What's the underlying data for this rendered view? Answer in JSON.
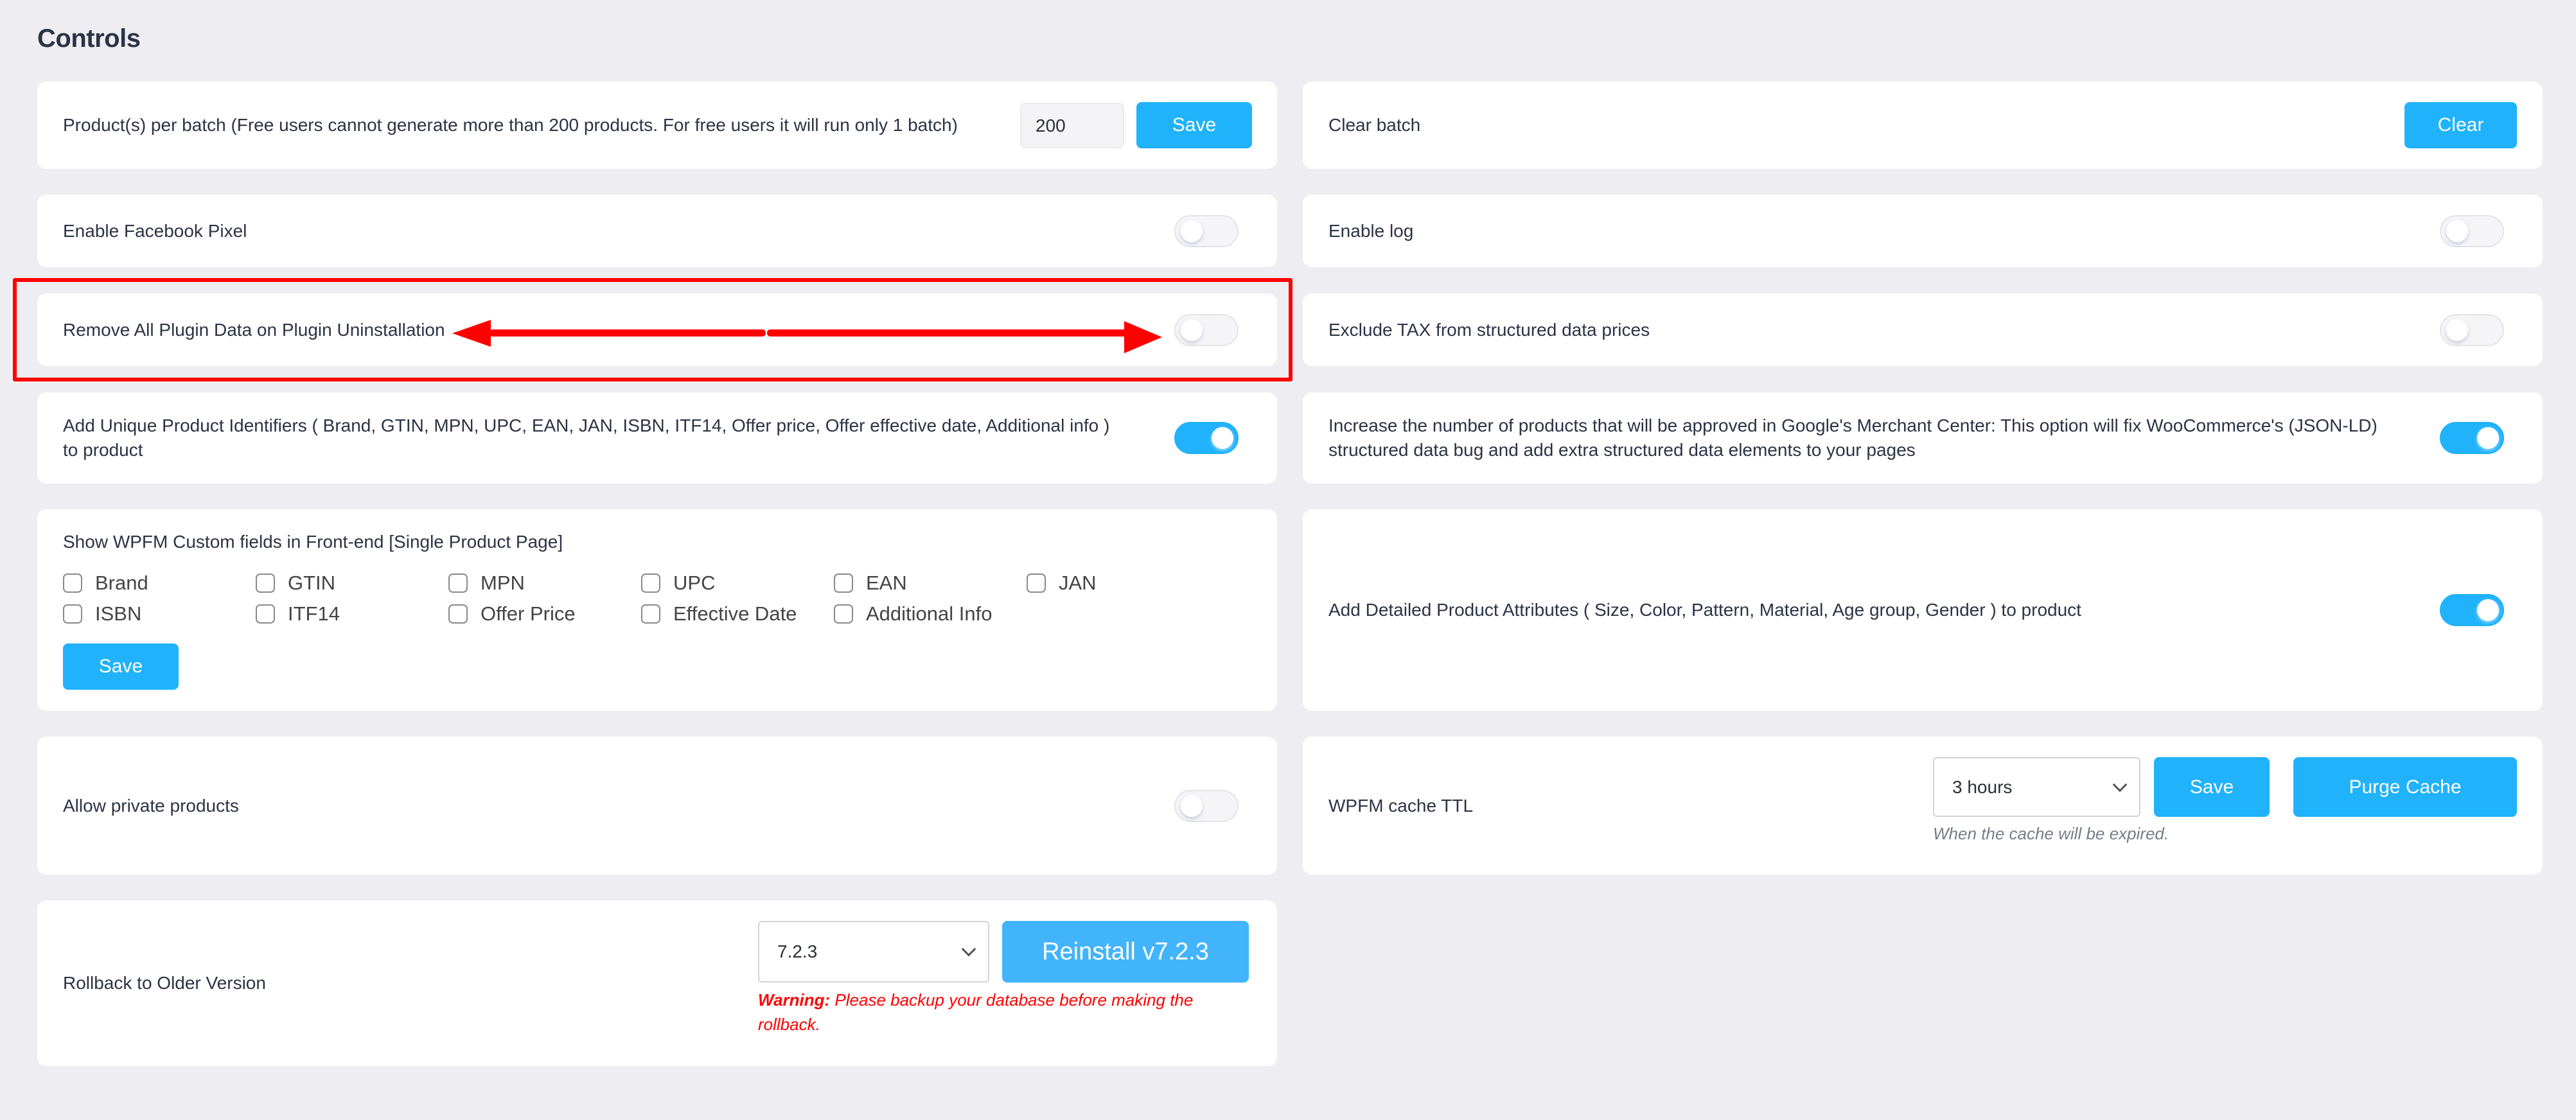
{
  "page": {
    "title": "Controls"
  },
  "colors": {
    "accent": "#20b2fb",
    "background": "#ededf2",
    "annotation": "#ff0000",
    "warning": "#ff0000"
  },
  "batch": {
    "label": "Product(s) per batch (Free users cannot generate more than 200 products. For free users it will run only 1 batch)",
    "value": "200",
    "save_label": "Save"
  },
  "clear_batch": {
    "label": "Clear batch",
    "button_label": "Clear"
  },
  "facebook_pixel": {
    "label": "Enable Facebook Pixel",
    "enabled": false
  },
  "enable_log": {
    "label": "Enable log",
    "enabled": false
  },
  "remove_data": {
    "label": "Remove All Plugin Data on Plugin Uninstallation",
    "enabled": false
  },
  "exclude_tax": {
    "label": "Exclude TAX from structured data prices",
    "enabled": false
  },
  "unique_identifiers": {
    "label": "Add Unique Product Identifiers ( Brand, GTIN, MPN, UPC, EAN, JAN, ISBN, ITF14, Offer price, Offer effective date, Additional info ) to product",
    "enabled": true
  },
  "merchant_center": {
    "label": "Increase the number of products that will be approved in Google's Merchant Center: This option will fix WooCommerce's (JSON-LD) structured data bug and add extra structured data elements to your pages",
    "enabled": true
  },
  "custom_fields": {
    "label": "Show WPFM Custom fields in Front-end [Single Product Page]",
    "options": [
      {
        "label": "Brand",
        "checked": false
      },
      {
        "label": "GTIN",
        "checked": false
      },
      {
        "label": "MPN",
        "checked": false
      },
      {
        "label": "UPC",
        "checked": false
      },
      {
        "label": "EAN",
        "checked": false
      },
      {
        "label": "JAN",
        "checked": false
      },
      {
        "label": "ISBN",
        "checked": false
      },
      {
        "label": "ITF14",
        "checked": false
      },
      {
        "label": "Offer Price",
        "checked": false
      },
      {
        "label": "Effective Date",
        "checked": false
      },
      {
        "label": "Additional Info",
        "checked": false
      }
    ],
    "save_label": "Save"
  },
  "detailed_attributes": {
    "label": "Add Detailed Product Attributes ( Size, Color, Pattern, Material, Age group, Gender ) to product",
    "enabled": true
  },
  "private_products": {
    "label": "Allow private products",
    "enabled": false
  },
  "cache_ttl": {
    "label": "WPFM cache TTL",
    "selected": "3 hours",
    "save_label": "Save",
    "purge_label": "Purge Cache",
    "hint": "When the cache will be expired."
  },
  "rollback": {
    "label": "Rollback to Older Version",
    "selected_version": "7.2.3",
    "button_label": "Reinstall v7.2.3",
    "warning_prefix": "Warning:",
    "warning_text": " Please backup your database before making the rollback."
  }
}
